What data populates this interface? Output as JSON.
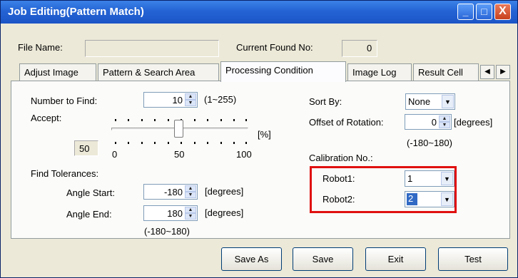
{
  "window": {
    "title": "Job Editing(Pattern Match)",
    "controls": {
      "minimize": "_",
      "maximize": "□",
      "close": "X"
    }
  },
  "file_name": {
    "label": "File Name:",
    "value": ""
  },
  "current_found": {
    "label": "Current Found No:",
    "value": "0"
  },
  "tabs": [
    {
      "label": "Adjust Image"
    },
    {
      "label": "Pattern & Search Area"
    },
    {
      "label": "Processing Condition"
    },
    {
      "label": "Image Log"
    },
    {
      "label": "Result Cell"
    }
  ],
  "tab_scroll": {
    "left": "◀",
    "right": "▶"
  },
  "number_to_find": {
    "label": "Number to Find:",
    "value": "10",
    "range": "(1~255)"
  },
  "accept": {
    "label": "Accept:",
    "value": "50",
    "unit": "[%]",
    "scale": [
      "0",
      "50",
      "100"
    ],
    "level_percent": 50
  },
  "find_tolerances": {
    "label": "Find Tolerances:",
    "angle_start": {
      "label": "Angle Start:",
      "value": "-180",
      "unit": "[degrees]"
    },
    "angle_end": {
      "label": "Angle End:",
      "value": "180",
      "unit": "[degrees]"
    },
    "range": "(-180~180)"
  },
  "sort_by": {
    "label": "Sort By:",
    "value": "None"
  },
  "offset_rotation": {
    "label": "Offset of Rotation:",
    "value": "0",
    "unit": "[degrees]",
    "range": "(-180~180)"
  },
  "calibration": {
    "label": "Calibration No.:",
    "robot1": {
      "label": "Robot1:",
      "value": "1"
    },
    "robot2": {
      "label": "Robot2:",
      "value": "2"
    },
    "highlight_color": "#e01010"
  },
  "buttons": {
    "save_as": "Save As",
    "save": "Save",
    "exit": "Exit",
    "test": "Test"
  },
  "colors": {
    "titlebar": "#2463d4",
    "window_bg": "#ece9d8",
    "selection": "#316ac5"
  }
}
